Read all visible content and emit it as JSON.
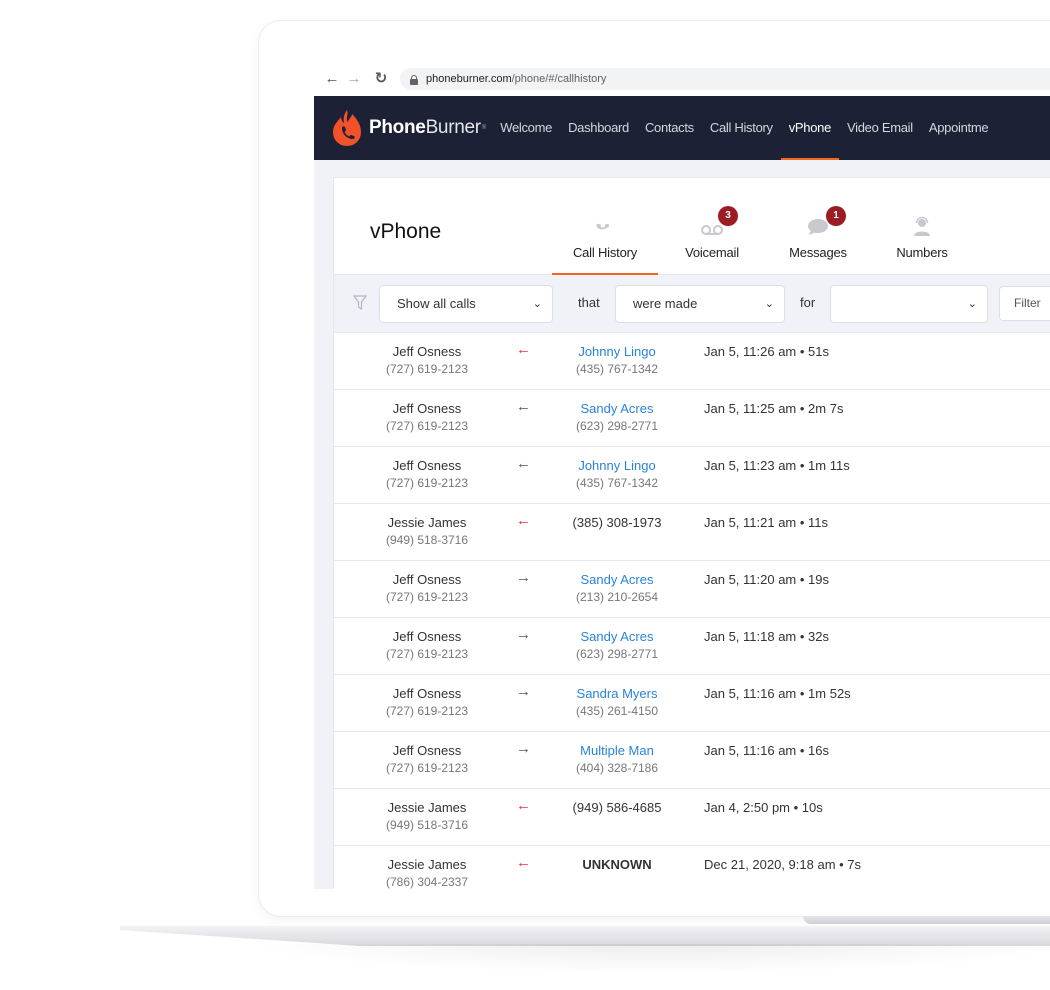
{
  "browser": {
    "url_host": "phoneburner.com",
    "url_path": "/phone/#/callhistory"
  },
  "app": {
    "logo_bold": "Phone",
    "logo_light": "Burner",
    "brand_color": "#f26722",
    "nav_bg": "#1c2135",
    "nav": [
      {
        "label": "Welcome",
        "active": false
      },
      {
        "label": "Dashboard",
        "active": false
      },
      {
        "label": "Contacts",
        "active": false
      },
      {
        "label": "Call History",
        "active": false
      },
      {
        "label": "vPhone",
        "active": true
      },
      {
        "label": "Video Email",
        "active": false
      },
      {
        "label": "Appointme",
        "active": false
      }
    ]
  },
  "page": {
    "title": "vPhone",
    "tabs": [
      {
        "label": "Call History",
        "icon": "phone-icon",
        "active": true
      },
      {
        "label": "Voicemail",
        "icon": "voicemail-icon",
        "badge": "3"
      },
      {
        "label": "Messages",
        "icon": "chat-bubble-icon",
        "badge": "1"
      },
      {
        "label": "Numbers",
        "icon": "headset-user-icon"
      }
    ]
  },
  "filters": {
    "show": "Show all calls",
    "that_label": "that",
    "made": "were made",
    "for_label": "for",
    "for_value": "",
    "filter_button": "Filter"
  },
  "calls": [
    {
      "from_name": "Jeff Osness",
      "from_phone": "(727) 619-2123",
      "direction": "inbound-missed",
      "arrow": "←",
      "to_name": "Johnny Lingo",
      "to_phone": "(435) 767-1342",
      "when": "Jan 5, 11:26 am • 51s"
    },
    {
      "from_name": "Jeff Osness",
      "from_phone": "(727) 619-2123",
      "direction": "inbound",
      "arrow": "←",
      "to_name": "Sandy Acres",
      "to_phone": "(623) 298-2771",
      "when": "Jan 5, 11:25 am • 2m 7s"
    },
    {
      "from_name": "Jeff Osness",
      "from_phone": "(727) 619-2123",
      "direction": "inbound",
      "arrow": "←",
      "to_name": "Johnny Lingo",
      "to_phone": "(435) 767-1342",
      "when": "Jan 5, 11:23 am • 1m 11s"
    },
    {
      "from_name": "Jessie James",
      "from_phone": "(949) 518-3716",
      "direction": "inbound-missed",
      "arrow": "←",
      "to_name": "(385) 308-1973",
      "to_phone": "",
      "when": "Jan 5, 11:21 am • 11s"
    },
    {
      "from_name": "Jeff Osness",
      "from_phone": "(727) 619-2123",
      "direction": "outbound",
      "arrow": "→",
      "to_name": "Sandy Acres",
      "to_phone": "(213) 210-2654",
      "when": "Jan 5, 11:20 am • 19s"
    },
    {
      "from_name": "Jeff Osness",
      "from_phone": "(727) 619-2123",
      "direction": "outbound",
      "arrow": "→",
      "to_name": "Sandy Acres",
      "to_phone": "(623) 298-2771",
      "when": "Jan 5, 11:18 am • 32s"
    },
    {
      "from_name": "Jeff Osness",
      "from_phone": "(727) 619-2123",
      "direction": "outbound",
      "arrow": "→",
      "to_name": "Sandra Myers",
      "to_phone": "(435) 261-4150",
      "when": "Jan 5, 11:16 am • 1m 52s"
    },
    {
      "from_name": "Jeff Osness",
      "from_phone": "(727) 619-2123",
      "direction": "outbound",
      "arrow": "→",
      "to_name": "Multiple Man",
      "to_phone": "(404) 328-7186",
      "when": "Jan 5, 11:16 am • 16s"
    },
    {
      "from_name": "Jessie James",
      "from_phone": "(949) 518-3716",
      "direction": "inbound-missed",
      "arrow": "←",
      "to_name": "(949) 586-4685",
      "to_phone": "",
      "when": "Jan 4, 2:50 pm • 10s"
    },
    {
      "from_name": "Jessie James",
      "from_phone": "(786) 304-2337",
      "direction": "inbound-missed",
      "arrow": "←",
      "to_name": "UNKNOWN",
      "to_phone": "",
      "when": "Dec 21, 2020, 9:18 am • 7s"
    }
  ]
}
